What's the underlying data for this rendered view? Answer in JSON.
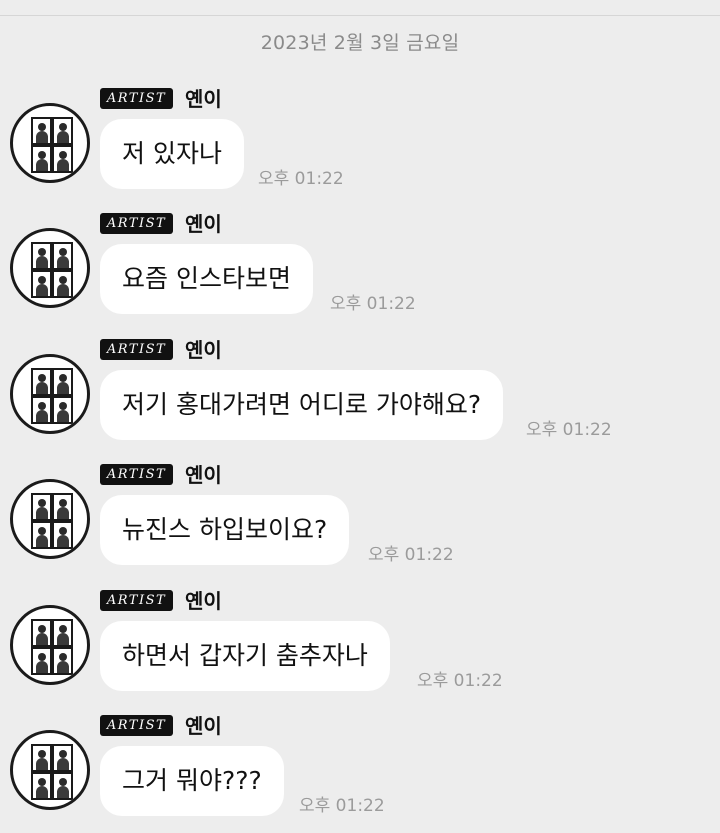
{
  "chat": {
    "date_header": "2023년 2월 3일 금요일",
    "messages": [
      {
        "badge": "ARTIST",
        "sender": "옌이",
        "text": "저 있자나",
        "time": "오후 01:22"
      },
      {
        "badge": "ARTIST",
        "sender": "옌이",
        "text": "요즘 인스타보면",
        "time": "오후 01:22"
      },
      {
        "badge": "ARTIST",
        "sender": "옌이",
        "text": "저기 홍대가려면 어디로 가야해요?",
        "time": "오후 01:22"
      },
      {
        "badge": "ARTIST",
        "sender": "옌이",
        "text": "뉴진스 하입보이요?",
        "time": "오후 01:22"
      },
      {
        "badge": "ARTIST",
        "sender": "옌이",
        "text": "하면서 갑자기 춤추자나",
        "time": "오후 01:22"
      },
      {
        "badge": "ARTIST",
        "sender": "옌이",
        "text": "그거 뭐야???",
        "time": "오후 01:22"
      }
    ]
  },
  "colors": {
    "background": "#ededed",
    "bubble": "#ffffff",
    "badge": "#111111",
    "timestamp": "#9b9b9b"
  },
  "icons": {
    "avatar": "profile-photo-strip"
  }
}
